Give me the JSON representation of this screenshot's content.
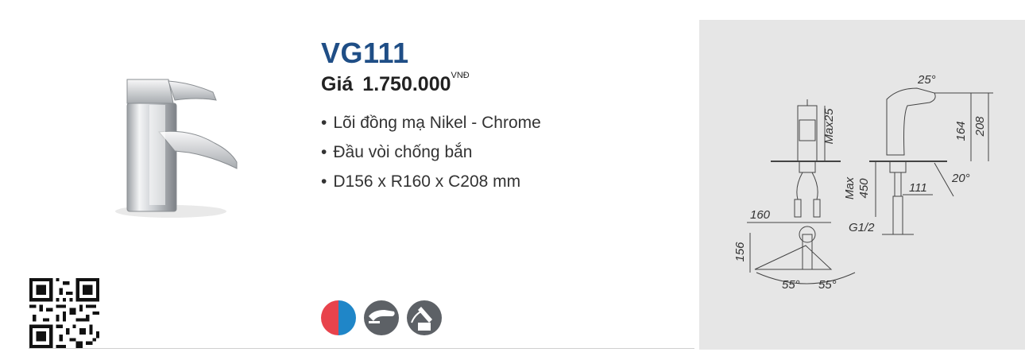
{
  "product": {
    "model": "VG111",
    "price_label": "Giá",
    "price_value": "1.750.000",
    "currency": "VNĐ",
    "features": [
      "Lõi đồng mạ Nikel - Chrome",
      "Đầu vòi chống bắn",
      "D156 x R160 x C208 mm"
    ]
  },
  "feature_icons": [
    "hot-cold-icon",
    "aerator-icon",
    "single-lever-icon"
  ],
  "colors": {
    "model": "#1f4e86",
    "hot": "#e8434c",
    "cold": "#1f86c8",
    "icon_bg": "#5d6166",
    "panel_bg": "#e6e6e6"
  },
  "drawing": {
    "labels": {
      "max25": "Max25",
      "angle_top": "25°",
      "h164": "164",
      "h208": "208",
      "max450_a": "Max",
      "max450_b": "450",
      "reach": "111",
      "angle_20": "20°",
      "w160": "160",
      "g12": "G1/2",
      "d156": "156",
      "angle_55_left": "55°",
      "angle_55_right": "55°"
    }
  }
}
